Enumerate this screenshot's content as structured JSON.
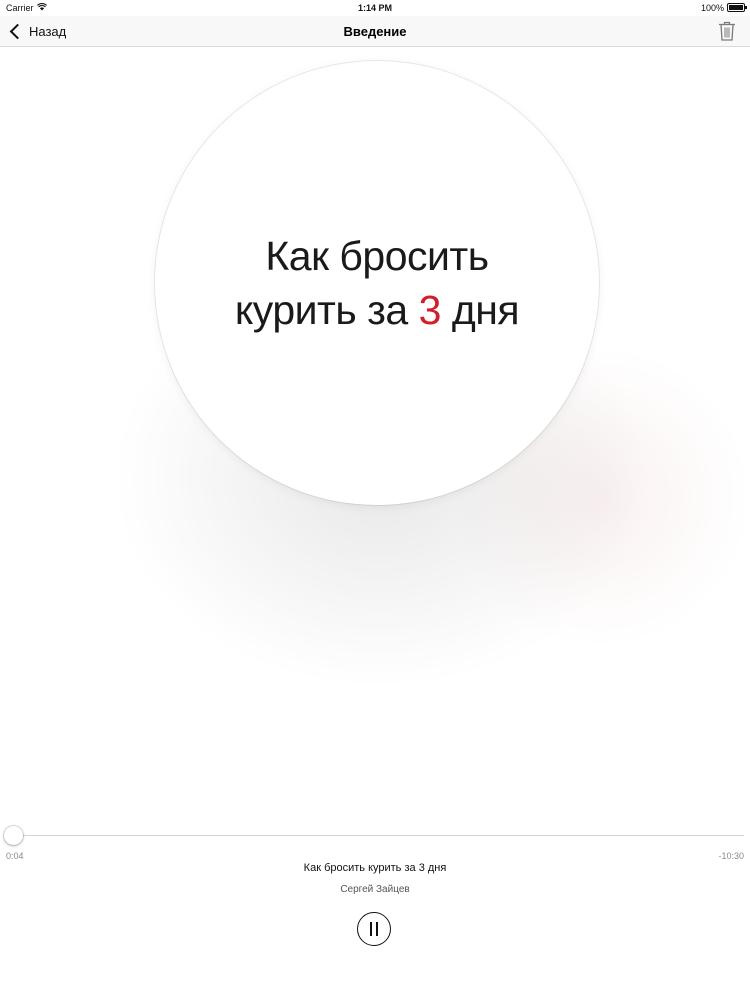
{
  "status_bar": {
    "carrier": "Carrier",
    "time": "1:14 PM",
    "battery": "100%"
  },
  "nav": {
    "back_label": "Назад",
    "title": "Введение",
    "trash_icon": "trash-icon"
  },
  "artwork": {
    "line1": "Как бросить",
    "line2_before": "курить за",
    "line2_number": "3",
    "line2_after": "дня",
    "number_color": "#d21e2b"
  },
  "player": {
    "elapsed": "0:04",
    "remaining": "-10:30",
    "progress_fraction": 0.006,
    "track_title": "Как бросить курить за 3 дня",
    "artist": "Сергей Зайцев",
    "pause_icon": "pause-icon"
  }
}
